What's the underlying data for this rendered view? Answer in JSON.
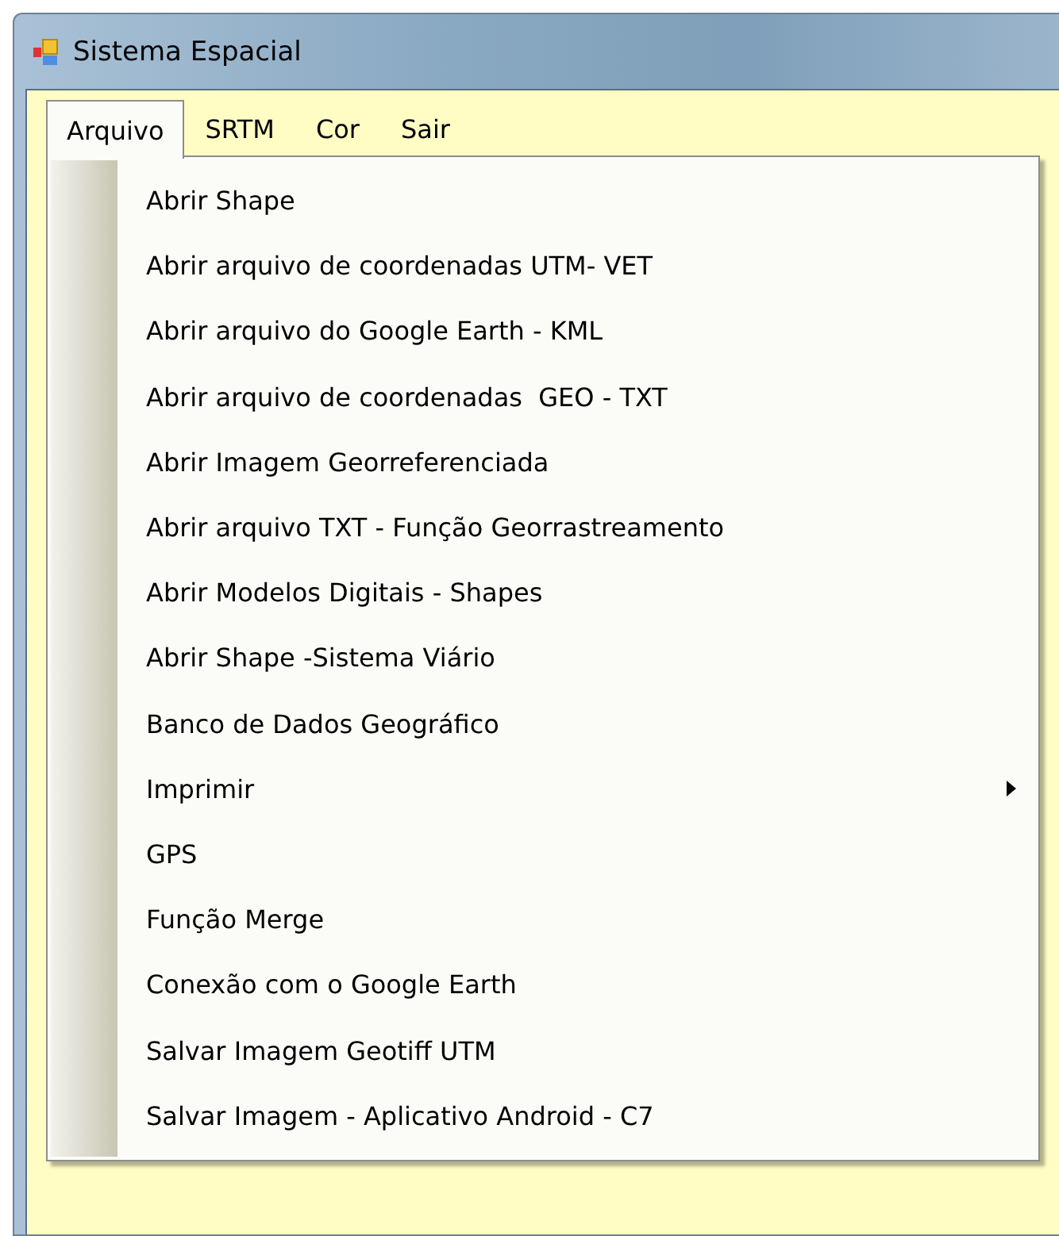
{
  "window": {
    "title": "Sistema Espacial"
  },
  "menubar": [
    {
      "label": "Arquivo",
      "selected": true
    },
    {
      "label": "SRTM",
      "selected": false
    },
    {
      "label": "Cor",
      "selected": false
    },
    {
      "label": "Sair",
      "selected": false
    }
  ],
  "menu": [
    {
      "label": "Abrir Shape",
      "submenu": false
    },
    {
      "label": "Abrir arquivo de coordenadas UTM- VET",
      "submenu": false
    },
    {
      "label": "Abrir arquivo do Google Earth - KML",
      "submenu": false
    },
    {
      "label": "Abrir arquivo de coordenadas  GEO - TXT",
      "submenu": false
    },
    {
      "label": "Abrir Imagem Georreferenciada",
      "submenu": false
    },
    {
      "label": "Abrir arquivo TXT - Função Georrastreamento",
      "submenu": false
    },
    {
      "label": "Abrir Modelos Digitais - Shapes",
      "submenu": false
    },
    {
      "label": "Abrir Shape -Sistema Viário",
      "submenu": false
    },
    {
      "label": "Banco de Dados Geográfico",
      "submenu": false
    },
    {
      "label": "Imprimir",
      "submenu": true
    },
    {
      "label": "GPS",
      "submenu": false
    },
    {
      "label": "Função Merge",
      "submenu": false
    },
    {
      "label": "Conexão com o Google Earth",
      "submenu": false
    },
    {
      "label": "Salvar Imagem Geotiff UTM",
      "submenu": false
    },
    {
      "label": "Salvar Imagem - Aplicativo Android - C7",
      "submenu": false
    }
  ]
}
